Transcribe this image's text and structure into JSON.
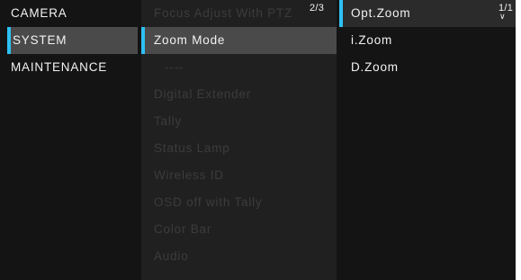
{
  "menu1": {
    "items": [
      {
        "label": "CAMERA"
      },
      {
        "label": "SYSTEM"
      },
      {
        "label": "MAINTENANCE"
      }
    ]
  },
  "menu2": {
    "page": "2/3",
    "items": [
      {
        "label": "Focus Adjust With PTZ"
      },
      {
        "label": "Zoom Mode"
      },
      {
        "label": "----"
      },
      {
        "label": "Digital Extender"
      },
      {
        "label": "Tally"
      },
      {
        "label": "Status Lamp"
      },
      {
        "label": "Wireless ID"
      },
      {
        "label": "OSD off with Tally"
      },
      {
        "label": "Color Bar"
      },
      {
        "label": "Audio"
      }
    ]
  },
  "menu3": {
    "page": "1/1",
    "items": [
      {
        "label": "Opt.Zoom"
      },
      {
        "label": "i.Zoom"
      },
      {
        "label": "D.Zoom"
      }
    ]
  },
  "colors": {
    "accent": "#2ec0f2",
    "highlight": "#4a4a4a",
    "background": "#141414",
    "panel": "#202020",
    "text": "#f2f2f2",
    "dim_text": "#3c3c3c"
  },
  "icons": {
    "scroll_down": "chevron-down-icon"
  }
}
